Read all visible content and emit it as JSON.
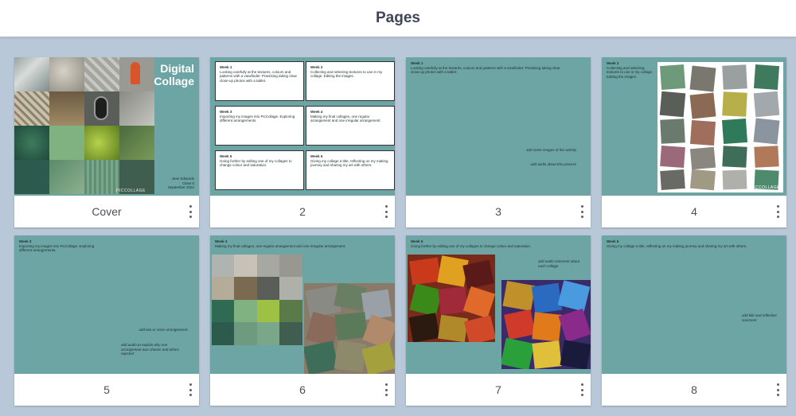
{
  "header": {
    "title": "Pages"
  },
  "pages": [
    {
      "label": "Cover"
    },
    {
      "label": "2"
    },
    {
      "label": "3"
    },
    {
      "label": "4"
    },
    {
      "label": "5"
    },
    {
      "label": "6"
    },
    {
      "label": "7"
    },
    {
      "label": "8"
    }
  ],
  "cover": {
    "title_line1": "Digital",
    "title_line2": "Collage",
    "author": "Jean Edwards",
    "class": "Class 5",
    "date": "September 2022",
    "watermark": "PICCOLLAGE"
  },
  "weeks": [
    {
      "title": "Week 1",
      "text": "Looking carefully at the textures, colours and patterns with a viewfinder. Practising taking clear close-up photos with a tablet."
    },
    {
      "title": "Week 2",
      "text": "Collecting and selecting textures to use in my collage. Editing the images."
    },
    {
      "title": "Week 3",
      "text": "Importing my images into PicCollage. Exploring different arrangements."
    },
    {
      "title": "Week 4",
      "text": "Making my final collages, one regular arrangement and one irregular arrangement."
    },
    {
      "title": "Week 5",
      "text": "Going further by editing one of my collages to change colour and saturation."
    },
    {
      "title": "Week 6",
      "text": "Giving my collage a title, reflecting on my making journey and sharing my art with others."
    }
  ],
  "page3": {
    "title": "Week 1",
    "text": "Looking carefully at the textures, colours and patterns with a viewfinder. Practising taking clear close-up photos with a tablet.",
    "note1": "add some images of the activity",
    "note2": "add audio about this process"
  },
  "page4": {
    "title": "Week 2",
    "text": "Collecting and selecting textures to use in my collage. Editing the images.",
    "watermark": "PICCOLLAGE"
  },
  "page5": {
    "title": "Week 3",
    "text": "Importing my images into PicCollage. Exploring different arrangements.",
    "note1": "add two or more arrangements",
    "note2": "add audio to explain why one arrangement was chosen and others rejected"
  },
  "page6": {
    "title": "Week 4",
    "text": "Making my final collages, one regular arrangement and one irregular arrangement."
  },
  "page7": {
    "title": "Week 5",
    "text": "Going further by editing one of my collages to change colour and saturation.",
    "note": "add audio comment about each collage"
  },
  "page8": {
    "title": "Week 6",
    "text": "Giving my collage a title, reflecting on my making journey and sharing my art with others.",
    "note": "add title and reflective comment"
  },
  "colors": {
    "page_bg": "#6da4a4",
    "app_bg": "#b9c8d9",
    "header_text": "#3c4658"
  }
}
